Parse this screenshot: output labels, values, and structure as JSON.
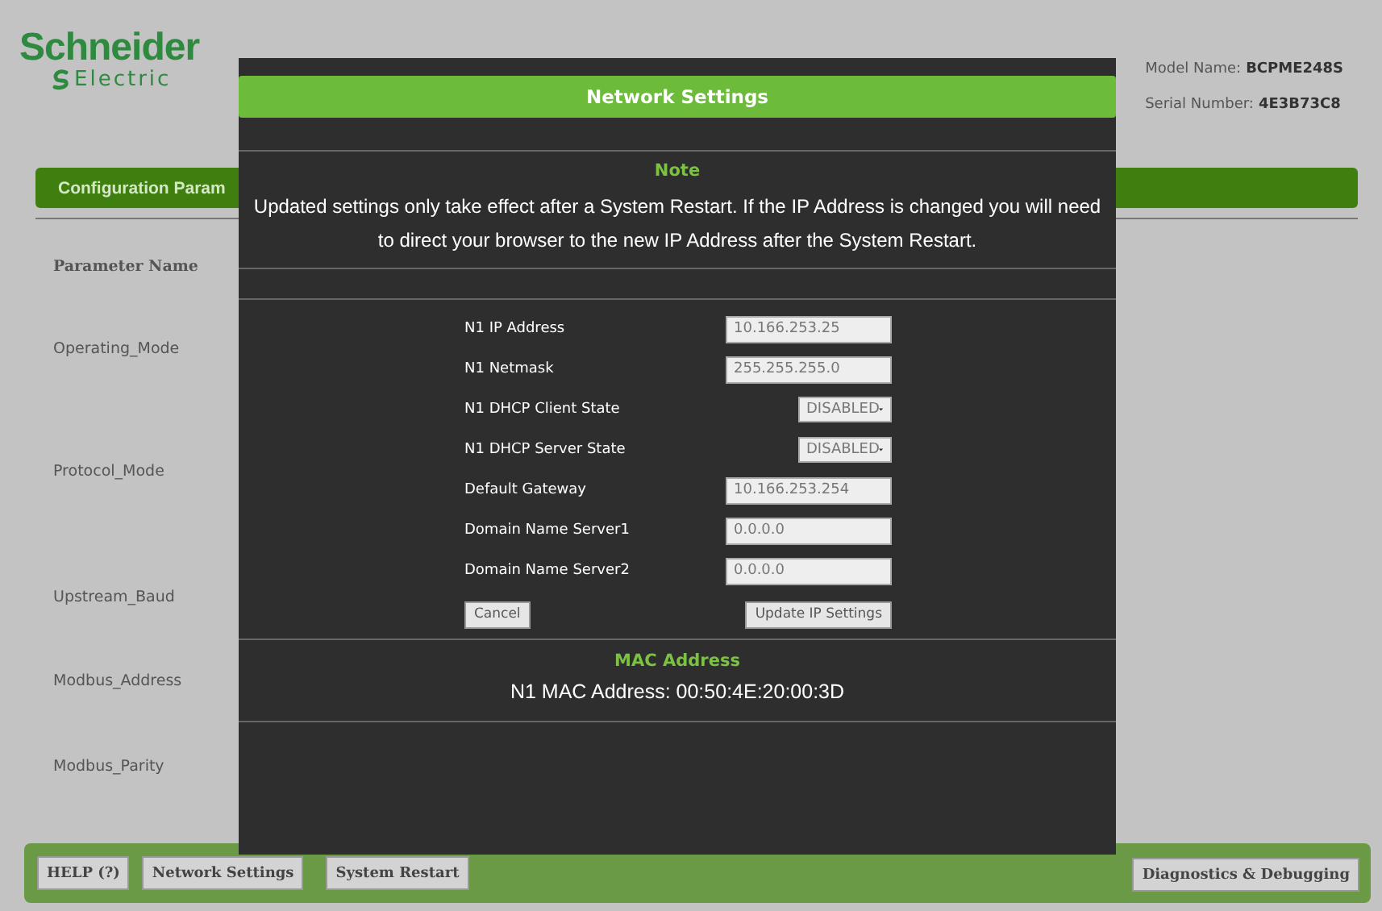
{
  "logo": {
    "line1": "Schneider",
    "line2": "Electric"
  },
  "device_info": [
    {
      "label": "Model Name:",
      "value": "BCPME248S"
    },
    {
      "label": "Serial Number:",
      "value": "4E3B73C8"
    }
  ],
  "section_title": "Configuration Param",
  "table": {
    "columns": [
      "Parameter Name"
    ],
    "rows": [
      "Operating_Mode",
      "Protocol_Mode",
      "Upstream_Baud",
      "Modbus_Address",
      "Modbus_Parity"
    ]
  },
  "footer": {
    "buttons": [
      "HELP (?)",
      "Network Settings",
      "System Restart"
    ],
    "right_button": "Diagnostics & Debugging"
  },
  "dialog": {
    "title": "Network Settings",
    "note_heading": "Note",
    "note_text": "Updated settings only take effect after a System Restart. If the IP Address is changed you will need to direct your browser to the new IP Address after the System Restart.",
    "fields": [
      {
        "kind": "text",
        "label": "N1 IP Address",
        "value": "10.166.253.25"
      },
      {
        "kind": "text",
        "label": "N1 Netmask",
        "value": "255.255.255.0"
      },
      {
        "kind": "select",
        "label": "N1 DHCP Client State",
        "value": "DISABLED"
      },
      {
        "kind": "select",
        "label": "N1 DHCP Server State",
        "value": "DISABLED"
      },
      {
        "kind": "text",
        "label": "Default Gateway",
        "value": "10.166.253.254"
      },
      {
        "kind": "text",
        "label": "Domain Name Server1",
        "value": "0.0.0.0"
      },
      {
        "kind": "text",
        "label": "Domain Name Server2",
        "value": "0.0.0.0"
      }
    ],
    "buttons": [
      "Cancel",
      "Update IP Settings"
    ],
    "mac_heading": "MAC Address",
    "mac_text": "N1 MAC Address: 00:50:4E:20:00:3D"
  }
}
